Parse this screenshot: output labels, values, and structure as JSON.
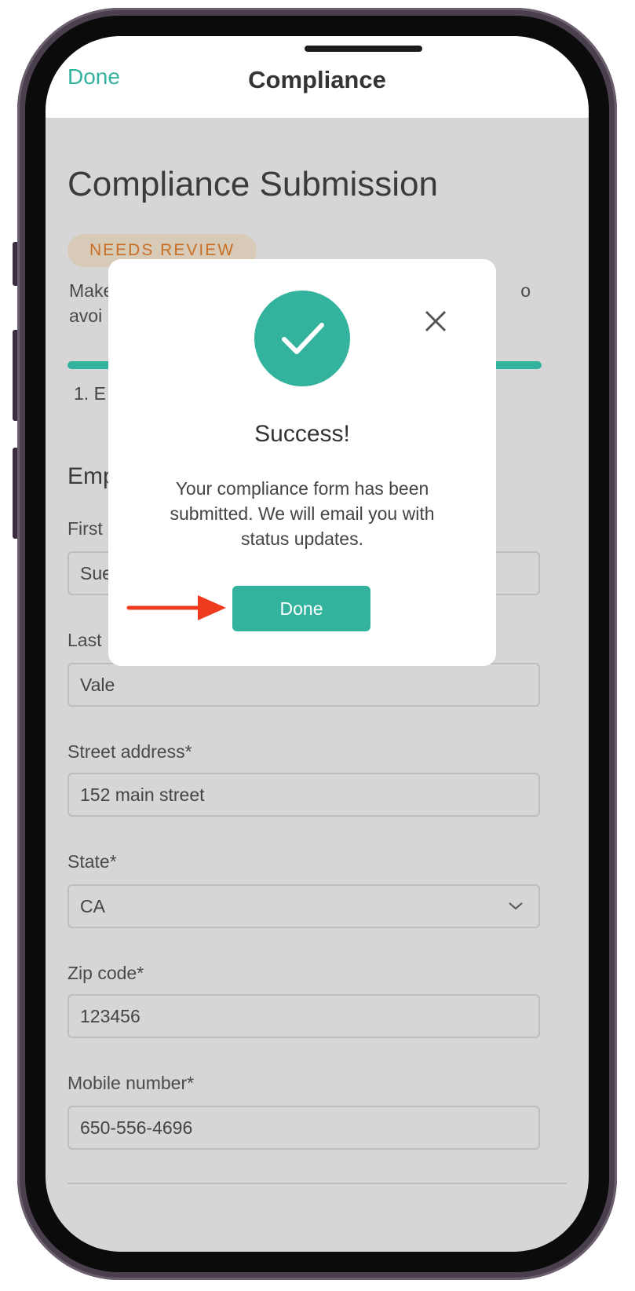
{
  "navbar": {
    "done_label": "Done",
    "title": "Compliance"
  },
  "page": {
    "title": "Compliance Submission",
    "badge": "NEEDS REVIEW",
    "intro_line1": "Make",
    "intro_line1_end": "o",
    "intro_line2": "avoi",
    "step_label": "1. E",
    "section_title": "Emp"
  },
  "form": {
    "first_name_label": "First",
    "first_name_value": "Sue",
    "last_name_label": "Last",
    "last_name_value": "Vale",
    "street_label": "Street address*",
    "street_value": "152 main street",
    "state_label": "State*",
    "state_value": "CA",
    "zip_label": "Zip code*",
    "zip_value": "123456",
    "mobile_label": "Mobile number*",
    "mobile_value": "650-556-4696"
  },
  "modal": {
    "title": "Success!",
    "body": "Your compliance form has been submitted. We will email you with status updates.",
    "done_label": "Done"
  },
  "colors": {
    "accent": "#33b39e",
    "badge_bg": "#d7cbb8",
    "badge_text": "#c96e25",
    "arrow": "#f03a1e"
  },
  "icons": {
    "check": "check-icon",
    "close": "close-icon",
    "chevron": "chevron-down-icon",
    "arrow": "arrow-right-icon"
  }
}
